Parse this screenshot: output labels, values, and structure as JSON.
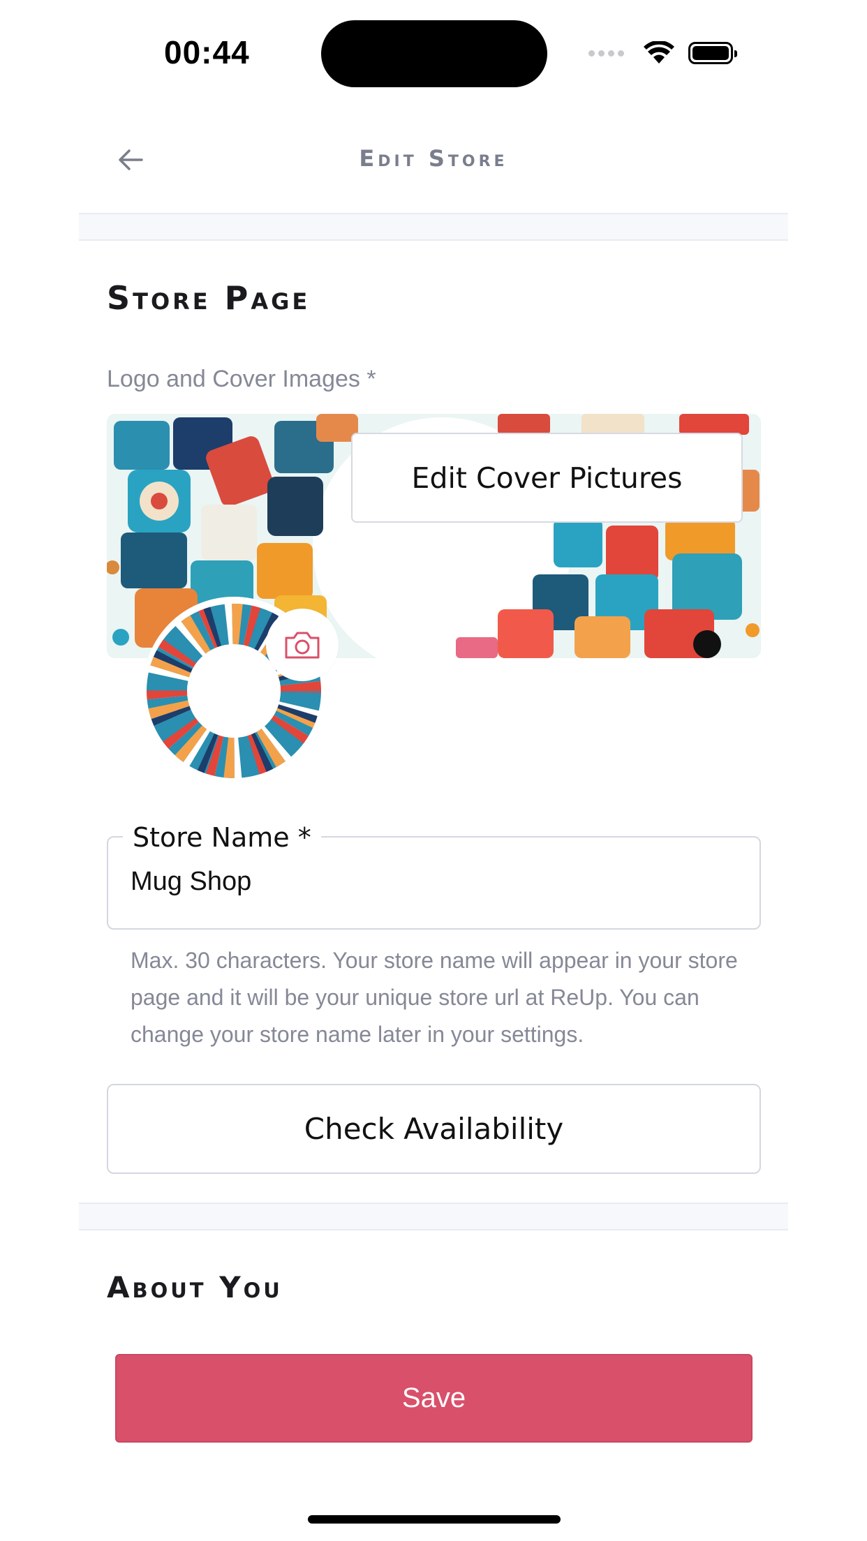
{
  "status_bar": {
    "time": "00:44"
  },
  "header": {
    "title": "Edit Store"
  },
  "store_page": {
    "section_title": "Store Page",
    "images_label": "Logo and Cover Images *",
    "edit_cover_label": "Edit Cover Pictures"
  },
  "store_name": {
    "label": "Store Name *",
    "value": "Mug Shop",
    "helper": "Max. 30 characters. Your store name will appear in your store page and it will be your unique store url at ReUp. You can change your store name later in your settings."
  },
  "check_button": {
    "label": "Check Availability"
  },
  "about": {
    "section_title": "About You"
  },
  "save_button": {
    "label": "Save"
  },
  "colors": {
    "accent": "#d9506a",
    "muted_text": "#858896",
    "border": "#d4d7e1"
  }
}
